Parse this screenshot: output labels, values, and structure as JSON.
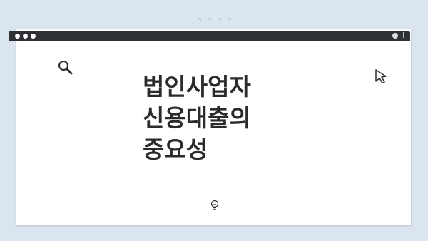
{
  "page": {
    "headline_lines": [
      "법인사업자",
      "신용대출의",
      "중요성"
    ]
  },
  "icons": {
    "search": "search-icon",
    "cursor": "cursor-icon",
    "bulb": "lightbulb-icon",
    "user": "user-icon",
    "menu": "kebab-menu-icon"
  },
  "colors": {
    "background": "#dbe5ef",
    "titlebar": "#2f3134",
    "text": "#2b2b2b"
  }
}
